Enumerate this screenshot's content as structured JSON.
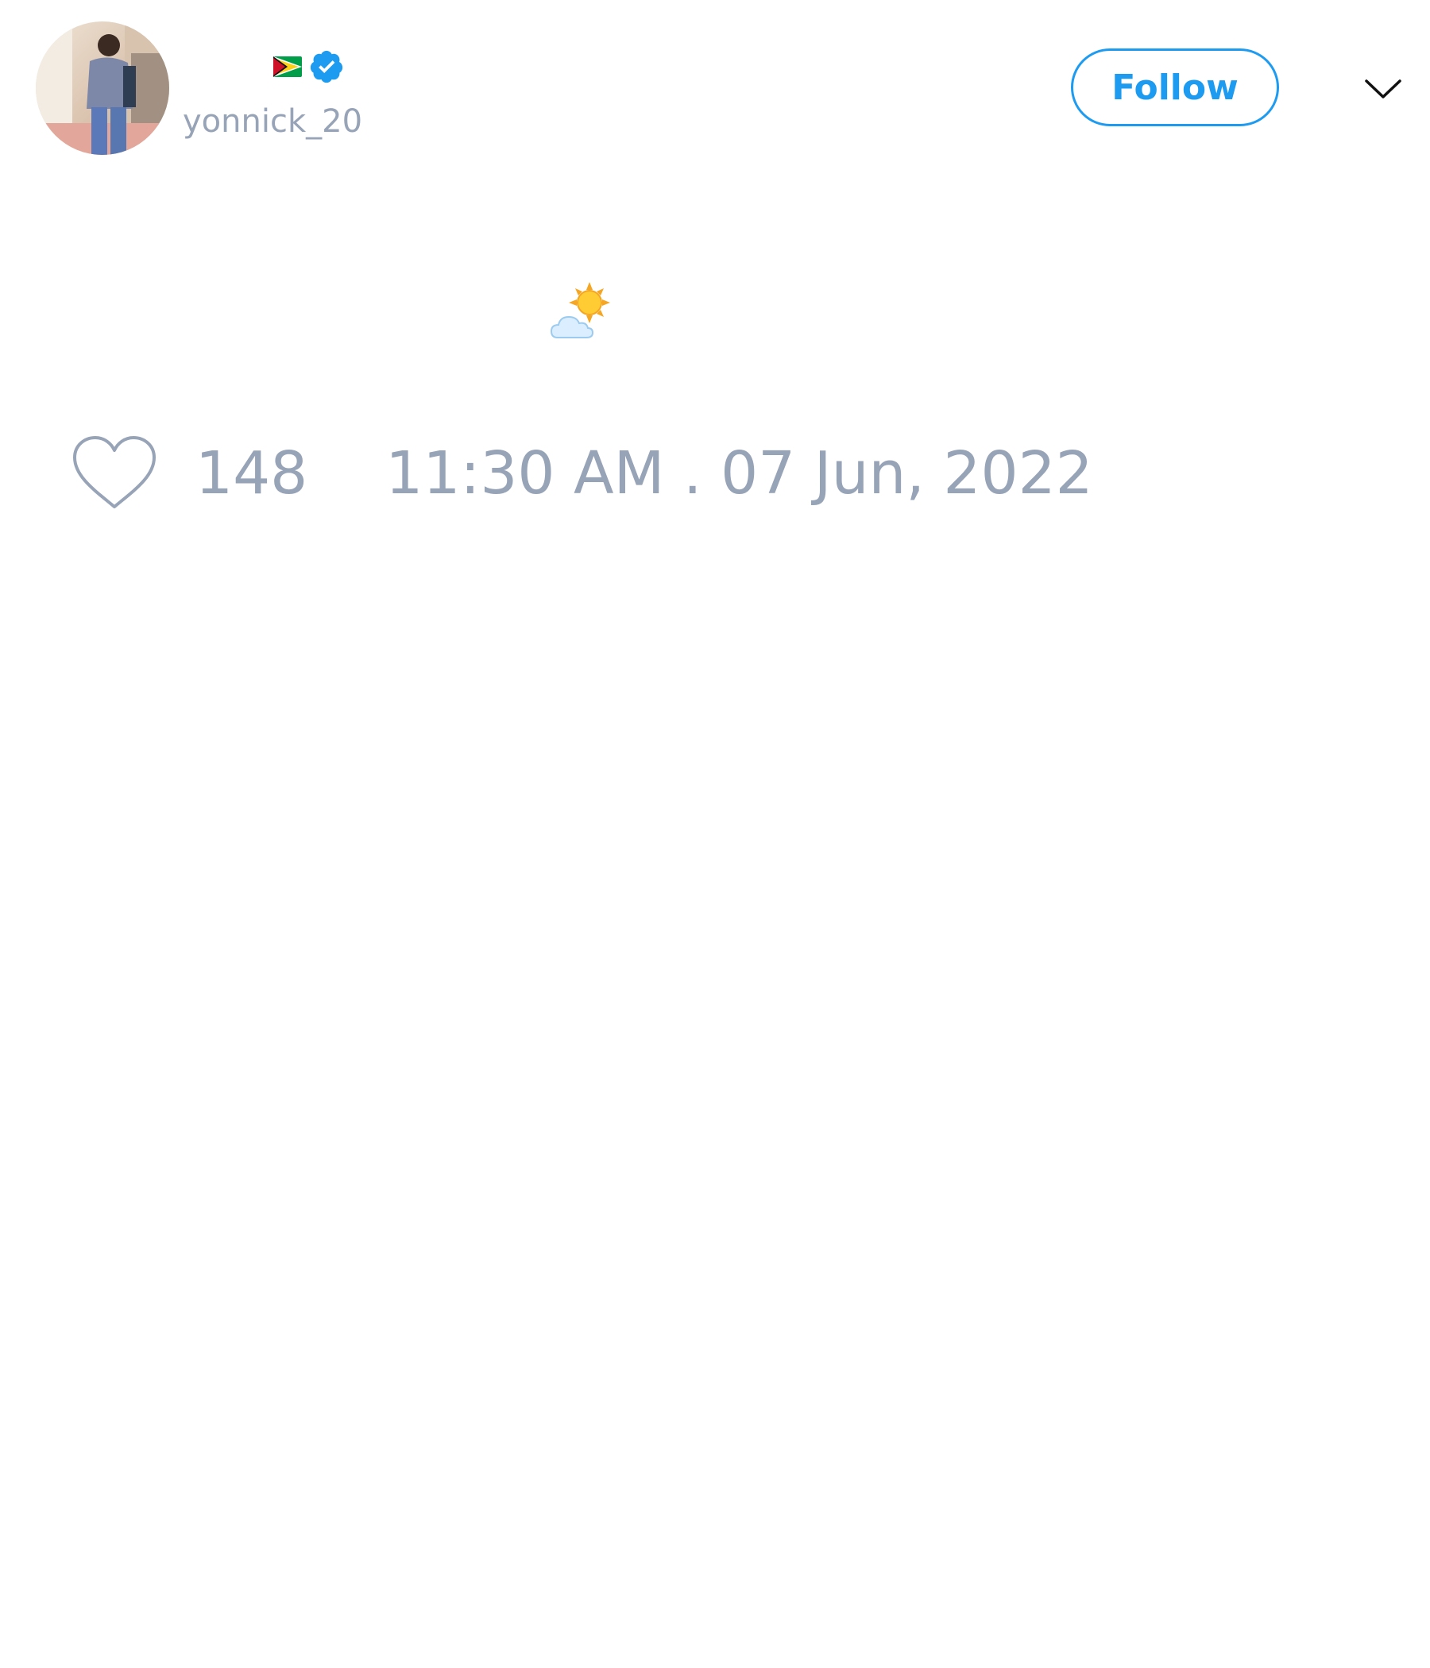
{
  "author": {
    "handle": "yonnick_20",
    "avatar_icon": "avatar-photo",
    "name_badges": [
      "guyana-flag-icon",
      "verified-badge-icon"
    ]
  },
  "actions": {
    "follow_label": "Follow",
    "more_icon": "chevron-down-icon"
  },
  "tweet": {
    "content_emoji": "sun-behind-cloud"
  },
  "stats": {
    "like_icon": "heart-icon",
    "likes": "148",
    "timestamp": "11:30 AM . 07 Jun, 2022"
  },
  "colors": {
    "accent": "#1d9bf0",
    "muted_text": "#97a3b6",
    "background": "#ffffff"
  }
}
